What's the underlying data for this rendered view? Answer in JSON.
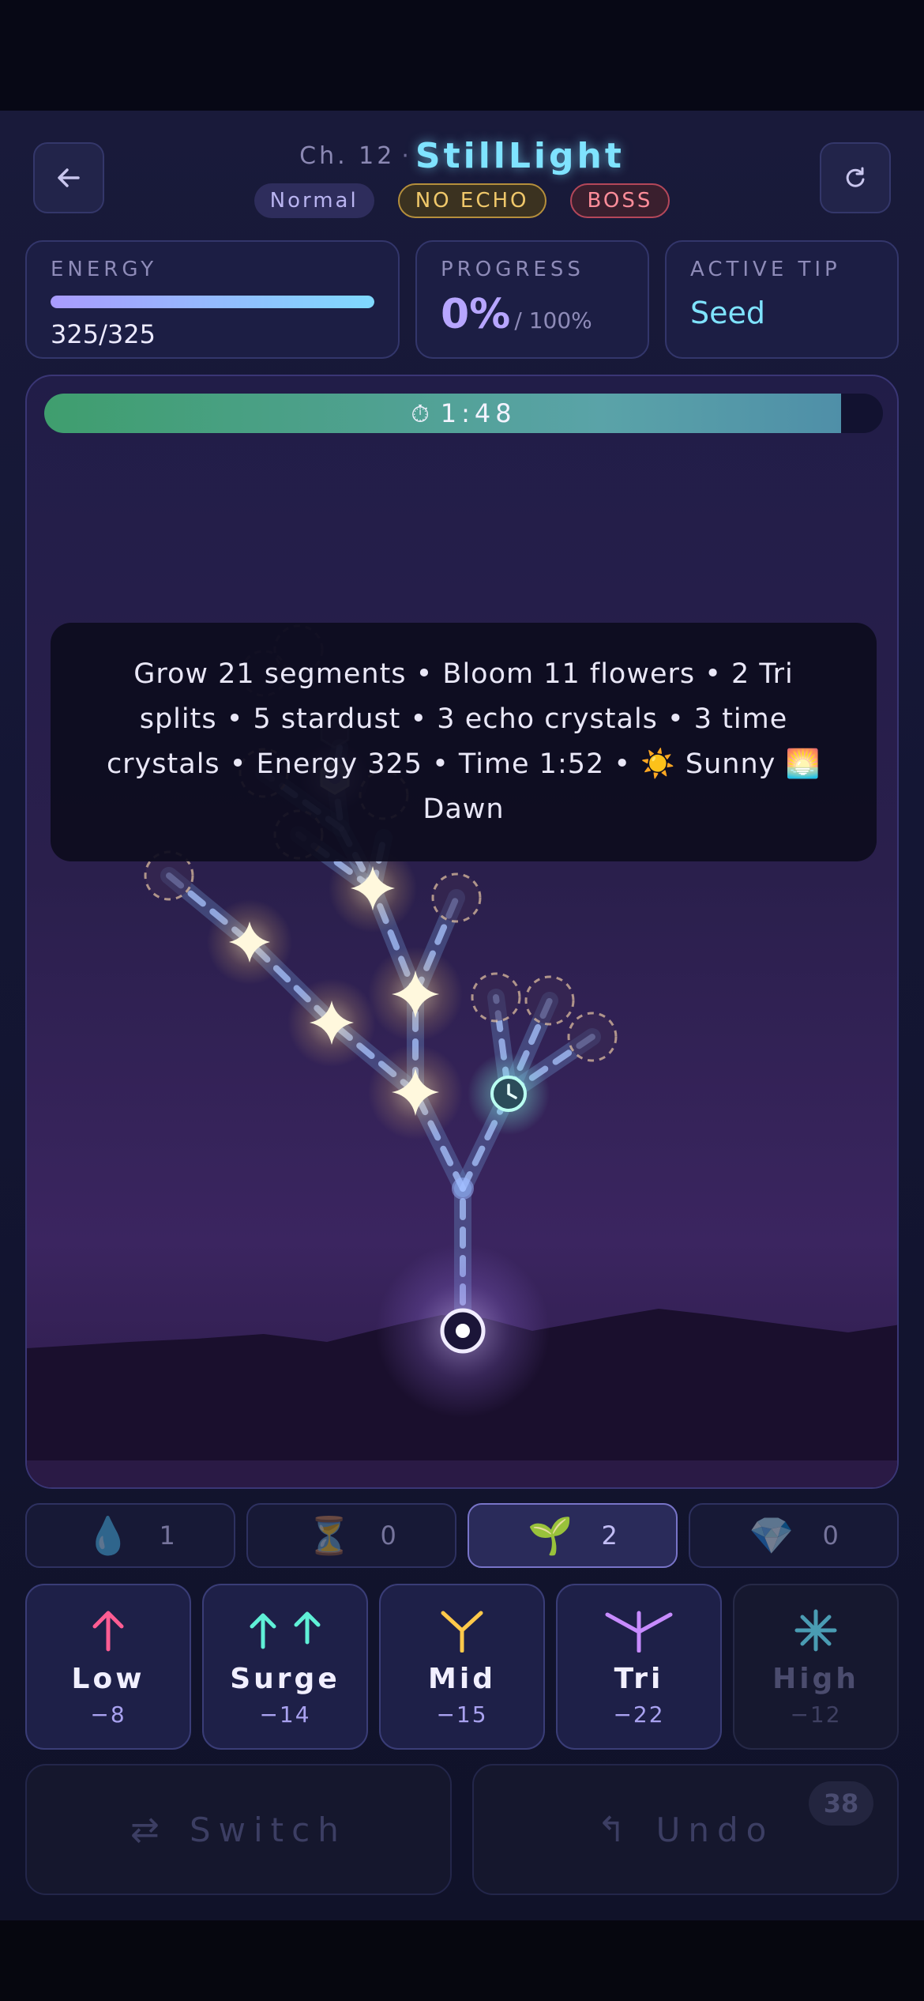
{
  "header": {
    "chapter": "Ch. 12",
    "separator": "·",
    "level_name": "StillLight",
    "badges": {
      "mode": "Normal",
      "no_echo": "NO ECHO",
      "boss": "BOSS"
    },
    "back_icon": "arrow-left-icon",
    "restart_icon": "restart-icon"
  },
  "stats": {
    "energy_label": "ENERGY",
    "energy_value": "325/325",
    "energy_fraction": 1.0,
    "progress_label": "PROGRESS",
    "progress_value": "0%",
    "progress_max": "/ 100%",
    "tip_label": "ACTIVE TIP",
    "tip_value": "Seed"
  },
  "game": {
    "timer_icon": "⏱",
    "timer_text": "1:48",
    "timer_fraction": 0.95,
    "objective": "Grow 21 segments • Bloom 11 flowers • 2 Tri splits • 5 stardust • 3 echo crystals • 3 time crystals • Energy 325 • Time 1:52 • ☀️ Sunny 🌅 Dawn"
  },
  "inventory": [
    {
      "icon": "💧",
      "icon_name": "water-drop-icon",
      "count": "1"
    },
    {
      "icon": "⏳",
      "icon_name": "hourglass-icon",
      "count": "0"
    },
    {
      "icon": "🌱",
      "icon_name": "sprout-icon",
      "count": "2"
    },
    {
      "icon": "💎",
      "icon_name": "gem-icon",
      "count": "0"
    }
  ],
  "moves": [
    {
      "label": "Low",
      "cost": "−8",
      "icon_name": "arrow-up-icon",
      "color": "#ff5d93"
    },
    {
      "label": "Surge",
      "cost": "−14",
      "icon_name": "double-arrow-up-icon",
      "color": "#5ff0d7"
    },
    {
      "label": "Mid",
      "cost": "−15",
      "icon_name": "fork-icon",
      "color": "#ffc94a"
    },
    {
      "label": "Tri",
      "cost": "−22",
      "icon_name": "trident-icon",
      "color": "#c78bff"
    },
    {
      "label": "High",
      "cost": "−12",
      "icon_name": "sparkle-icon",
      "color": "#4a9cb3"
    }
  ],
  "actions": {
    "switch_label": "Switch",
    "switch_icon": "⇄",
    "undo_label": "Undo",
    "undo_icon": "↰",
    "undo_count": "38"
  }
}
